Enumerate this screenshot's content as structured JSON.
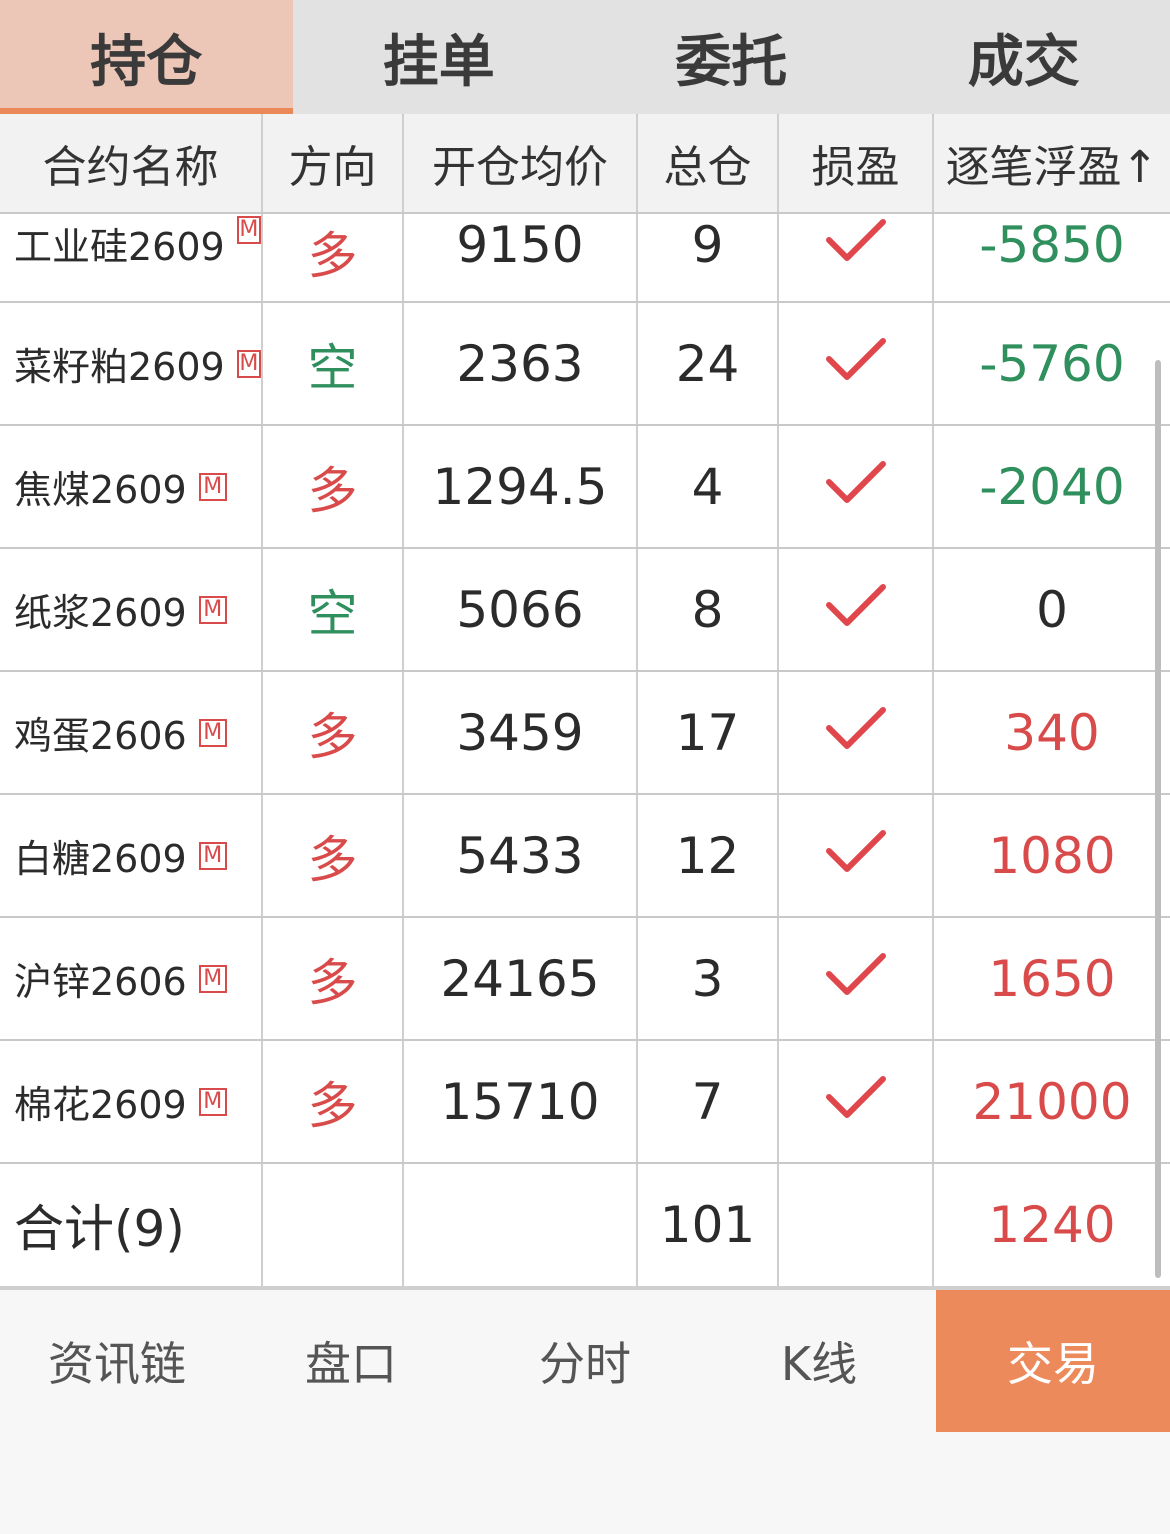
{
  "tabs": [
    {
      "label": "持仓",
      "active": true
    },
    {
      "label": "挂单",
      "active": false
    },
    {
      "label": "委托",
      "active": false
    },
    {
      "label": "成交",
      "active": false
    }
  ],
  "header": {
    "name": "合约名称",
    "direction": "方向",
    "avg_price": "开仓均价",
    "total": "总仓",
    "stop": "损盈",
    "float_pl": "逐笔浮盈↑"
  },
  "badge": "M",
  "rows": [
    {
      "name": "工业硅2609",
      "direction": "多",
      "dir_type": "long",
      "avg_price": "9150",
      "total": "9",
      "float_pl": "-5850",
      "pl_type": "neg"
    },
    {
      "name": "菜籽粕2609",
      "direction": "空",
      "dir_type": "short",
      "avg_price": "2363",
      "total": "24",
      "float_pl": "-5760",
      "pl_type": "neg"
    },
    {
      "name": "焦煤2609",
      "direction": "多",
      "dir_type": "long",
      "avg_price": "1294.5",
      "total": "4",
      "float_pl": "-2040",
      "pl_type": "neg"
    },
    {
      "name": "纸浆2609",
      "direction": "空",
      "dir_type": "short",
      "avg_price": "5066",
      "total": "8",
      "float_pl": "0",
      "pl_type": "zero"
    },
    {
      "name": "鸡蛋2606",
      "direction": "多",
      "dir_type": "long",
      "avg_price": "3459",
      "total": "17",
      "float_pl": "340",
      "pl_type": "pos"
    },
    {
      "name": "白糖2609",
      "direction": "多",
      "dir_type": "long",
      "avg_price": "5433",
      "total": "12",
      "float_pl": "1080",
      "pl_type": "pos"
    },
    {
      "name": "沪锌2606",
      "direction": "多",
      "dir_type": "long",
      "avg_price": "24165",
      "total": "3",
      "float_pl": "1650",
      "pl_type": "pos"
    },
    {
      "name": "棉花2609",
      "direction": "多",
      "dir_type": "long",
      "avg_price": "15710",
      "total": "7",
      "float_pl": "21000",
      "pl_type": "pos"
    }
  ],
  "total_row": {
    "label": "合计(9)",
    "total": "101",
    "float_pl": "1240"
  },
  "bottom_nav": [
    {
      "label": "资讯链",
      "active": false
    },
    {
      "label": "盘口",
      "active": false
    },
    {
      "label": "分时",
      "active": false
    },
    {
      "label": "K线",
      "active": false
    },
    {
      "label": "交易",
      "active": true
    }
  ],
  "colors": {
    "accent": "#ec8a5b",
    "long": "#d94b4b",
    "short": "#2f8f5d"
  }
}
